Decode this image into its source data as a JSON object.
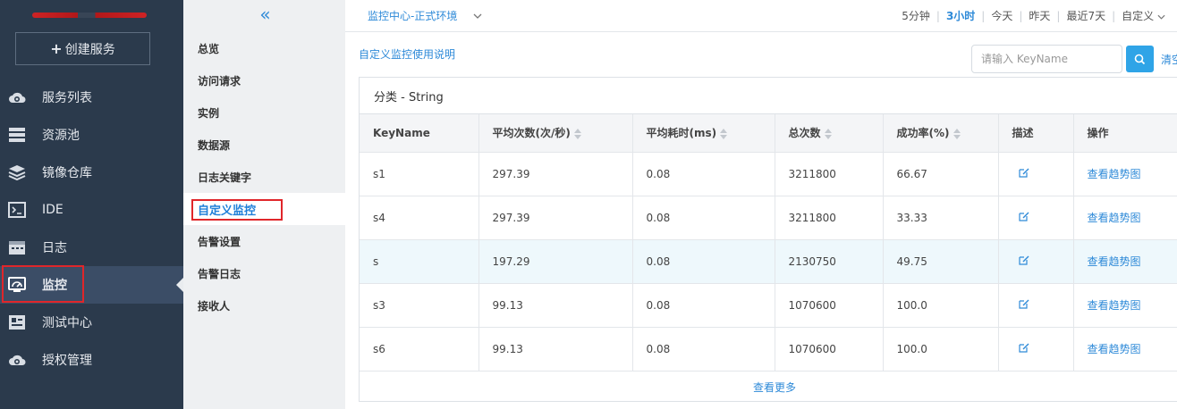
{
  "sidebar": {
    "create_label": "创建服务",
    "items": [
      {
        "label": "服务列表",
        "icon": "cloud-gear-icon"
      },
      {
        "label": "资源池",
        "icon": "server-stack-icon"
      },
      {
        "label": "镜像仓库",
        "icon": "layers-icon"
      },
      {
        "label": "IDE",
        "icon": "terminal-icon"
      },
      {
        "label": "日志",
        "icon": "calendar-log-icon"
      },
      {
        "label": "监控",
        "icon": "monitor-gauge-icon"
      },
      {
        "label": "测试中心",
        "icon": "test-doc-icon"
      },
      {
        "label": "授权管理",
        "icon": "cloud-gear-icon"
      }
    ],
    "active": "监控",
    "bg_color": "#2b3a4c",
    "active_color": "#3b4d66"
  },
  "submenu": {
    "collapse_icon": "«",
    "items": [
      "总览",
      "访问请求",
      "实例",
      "数据源",
      "日志关键字",
      "自定义监控",
      "告警设置",
      "告警日志",
      "接收人"
    ],
    "active": "自定义监控"
  },
  "topbar": {
    "env_label": "监控中心-正式环境",
    "time_ranges": [
      "5分钟",
      "3小时",
      "今天",
      "昨天",
      "最近7天",
      "自定义"
    ],
    "active_range": "3小时"
  },
  "main": {
    "help_link": "自定义监控使用说明",
    "search_placeholder": "请输入 KeyName",
    "clear_label": "清空",
    "panel_title": "分类 - String",
    "columns": [
      "KeyName",
      "平均次数(次/秒)",
      "平均耗时(ms)",
      "总次数",
      "成功率(%)",
      "描述",
      "操作"
    ],
    "rows": [
      [
        "s1",
        "297.39",
        "0.08",
        "3211800",
        "66.67"
      ],
      [
        "s4",
        "297.39",
        "0.08",
        "3211800",
        "33.33"
      ],
      [
        "s",
        "197.29",
        "0.08",
        "2130750",
        "49.75"
      ],
      [
        "s3",
        "99.13",
        "0.08",
        "1070600",
        "100.0"
      ],
      [
        "s6",
        "99.13",
        "0.08",
        "1070600",
        "100.0"
      ]
    ],
    "row_action": "查看趋势图",
    "more_label": "查看更多",
    "accent_color": "#2e8ad8"
  }
}
